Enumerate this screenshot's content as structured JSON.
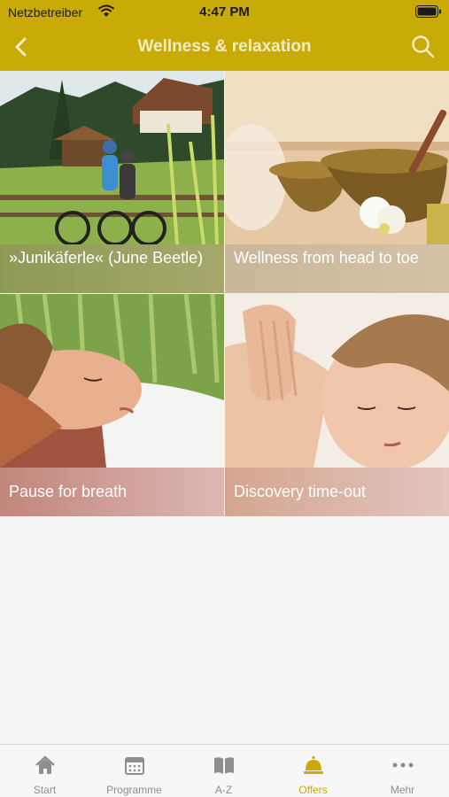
{
  "status": {
    "carrier": "Netzbetreiber",
    "time": "4:47 PM"
  },
  "header": {
    "title": "Wellness & relaxation",
    "accent": "#c8ab06"
  },
  "tiles": [
    {
      "caption": "»Junikäferle« (June Beetle)"
    },
    {
      "caption": "Wellness from head to toe"
    },
    {
      "caption": "Pause for breath"
    },
    {
      "caption": "Discovery time-out"
    }
  ],
  "tabs": [
    {
      "label": "Start",
      "icon": "house-icon"
    },
    {
      "label": "Programme",
      "icon": "calendar-icon"
    },
    {
      "label": "A-Z",
      "icon": "book-icon"
    },
    {
      "label": "Offers",
      "icon": "service-bell-icon",
      "active": true
    },
    {
      "label": "Mehr",
      "icon": "more-dots-icon"
    }
  ]
}
